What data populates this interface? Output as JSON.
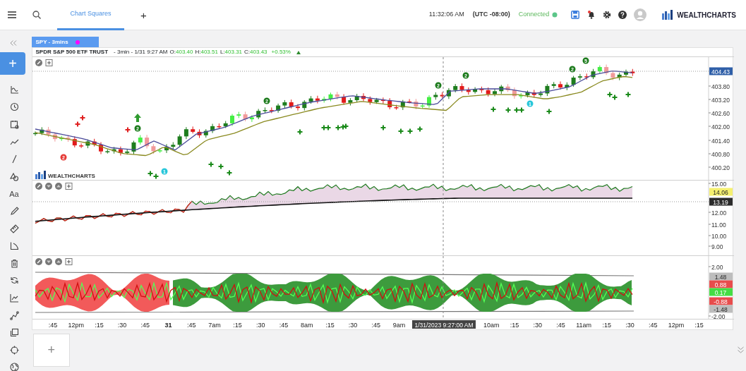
{
  "topbar": {
    "tabs": [
      {
        "label": "Chart Squares",
        "selected": true
      }
    ],
    "add_tab": "+",
    "time": "11:32:06 AM",
    "timezone": "(UTC -08:00)",
    "connection": {
      "label": "Connected",
      "connected": true
    },
    "notification": true,
    "logo": "WEALTHCHARTS"
  },
  "sidebar": {
    "add_button": "+",
    "text_tool": "Aa"
  },
  "chart": {
    "symbol_tab": "SPY - 3mins",
    "title": "SPDR S&P 500 ETF TRUST",
    "interval": "- 3min - 1/31 9:27 AM",
    "ohlc": [
      {
        "label": "O:",
        "value": "403.40"
      },
      {
        "label": "H:",
        "value": "403.51"
      },
      {
        "label": "L:",
        "value": "403.31"
      },
      {
        "label": "C:",
        "value": "403.43"
      }
    ],
    "change": "+0.53%",
    "change_up": true,
    "watermark": "WEALTHCHARTS",
    "markers": [
      {
        "label": "2",
        "color": "#e53935"
      },
      {
        "label": "2",
        "color": "#1b7a1b"
      },
      {
        "label": "1",
        "color": "#26c6da"
      },
      {
        "label": "2",
        "color": "#1b7a1b"
      },
      {
        "label": "2",
        "color": "#1b7a1b"
      },
      {
        "label": "2",
        "color": "#1b7a1b"
      },
      {
        "label": "1",
        "color": "#26c6da"
      },
      {
        "label": "2",
        "color": "#1b7a1b"
      },
      {
        "label": "5",
        "color": "#1b7a1b"
      }
    ],
    "price_axis": [
      {
        "text": "404.43",
        "kind": "badge",
        "color": "#2f5fa8"
      },
      {
        "text": "403.80",
        "kind": "tick"
      },
      {
        "text": "403.20",
        "kind": "tick"
      },
      {
        "text": "402.60",
        "kind": "tick"
      },
      {
        "text": "402.00",
        "kind": "tick"
      },
      {
        "text": "401.40",
        "kind": "tick"
      },
      {
        "text": "400.80",
        "kind": "tick"
      },
      {
        "text": "400.20",
        "kind": "tick"
      }
    ],
    "indicator_axis": [
      {
        "text": "15.00",
        "kind": "tick"
      },
      {
        "text": "14.06",
        "kind": "badge",
        "color": "#f5f070"
      },
      {
        "text": "13.19",
        "kind": "badge",
        "color": "#2b2b2b"
      },
      {
        "text": "12.00",
        "kind": "tick"
      },
      {
        "text": "11.00",
        "kind": "tick"
      },
      {
        "text": "10.00",
        "kind": "tick"
      },
      {
        "text": "9.00",
        "kind": "tick"
      }
    ],
    "oscillator_axis": [
      {
        "text": "2.00",
        "kind": "tick"
      },
      {
        "text": "1.48",
        "kind": "badge",
        "color": "#bdbdbd"
      },
      {
        "text": "0.88",
        "kind": "badge",
        "color": "#e84c4c"
      },
      {
        "text": "0.17",
        "kind": "badge",
        "color": "#44dd44"
      },
      {
        "text": "-0.88",
        "kind": "badge",
        "color": "#e84c4c"
      },
      {
        "text": "-1.48",
        "kind": "badge",
        "color": "#bdbdbd"
      },
      {
        "text": "-2.00",
        "kind": "tick"
      }
    ],
    "time_axis": [
      {
        "text": ":45",
        "kind": "tick"
      },
      {
        "text": "12pm",
        "kind": "tick"
      },
      {
        "text": ":15",
        "kind": "tick"
      },
      {
        "text": ":30",
        "kind": "tick"
      },
      {
        "text": ":45",
        "kind": "tick"
      },
      {
        "text": "31",
        "kind": "day"
      },
      {
        "text": ":45",
        "kind": "tick"
      },
      {
        "text": "7am",
        "kind": "tick"
      },
      {
        "text": ":15",
        "kind": "tick"
      },
      {
        "text": ":30",
        "kind": "tick"
      },
      {
        "text": ":45",
        "kind": "tick"
      },
      {
        "text": "8am",
        "kind": "tick"
      },
      {
        "text": ":15",
        "kind": "tick"
      },
      {
        "text": ":30",
        "kind": "tick"
      },
      {
        "text": ":45",
        "kind": "tick"
      },
      {
        "text": "9am",
        "kind": "tick"
      },
      {
        "text": "1/31/2023 9:27:00 AM",
        "kind": "cursor"
      },
      {
        "text": "10am",
        "kind": "tick"
      },
      {
        "text": ":15",
        "kind": "tick"
      },
      {
        "text": ":30",
        "kind": "tick"
      },
      {
        "text": ":45",
        "kind": "tick"
      },
      {
        "text": "11am",
        "kind": "tick"
      },
      {
        "text": ":15",
        "kind": "tick"
      },
      {
        "text": ":30",
        "kind": "tick"
      },
      {
        "text": ":45",
        "kind": "tick"
      },
      {
        "text": "12pm",
        "kind": "tick"
      },
      {
        "text": ":15",
        "kind": "tick"
      }
    ]
  },
  "footer": {
    "add_layout": "+"
  }
}
